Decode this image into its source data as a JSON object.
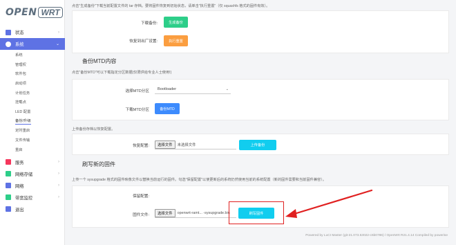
{
  "logo": {
    "open": "OPEN",
    "wrt": "WRT"
  },
  "menu": [
    {
      "label": "状态",
      "icon": "dashboard-icon",
      "color": "#5e72e4",
      "active": false
    },
    {
      "label": "系统",
      "icon": "gear-icon",
      "color": "#5e72e4",
      "active": true
    }
  ],
  "submenu": [
    "系统",
    "管理权",
    "软件包",
    "启动项",
    "计划任务",
    "挂载点",
    "LED 配置",
    "备份/升级",
    "定时重启",
    "文件传输",
    "重启"
  ],
  "menu_bottom": [
    {
      "label": "服务",
      "icon": "services-icon",
      "color": "#f5365c"
    },
    {
      "label": "网络存储",
      "icon": "storage-icon",
      "color": "#2dce89"
    },
    {
      "label": "网络",
      "icon": "network-icon",
      "color": "#5e72e4"
    },
    {
      "label": "带宽监控",
      "icon": "monitor-icon",
      "color": "#2dce89"
    },
    {
      "label": "退出",
      "icon": "logout-icon",
      "color": "#5e72e4"
    }
  ],
  "top_note": "点击\"生成备份\"下载当前配置文件的 tar 存档。要将固件恢复到初始状态，请单击\"执行重置\"（仅 squashfs 格式的固件有效）。",
  "backup": {
    "download_label": "下载备份:",
    "download_btn": "生成备份",
    "reset_label": "恢复到出厂设置:",
    "reset_btn": "执行重置"
  },
  "mtd": {
    "title": "备份MTD内容",
    "note": "点击\"备份MTD\"可以下载指定分区数据(仅限供给专业人士使用!)",
    "select_label": "选择MTD分区",
    "select_value": "Bootloader",
    "download_label": "下载MTD分区",
    "download_btn": "备份MTD"
  },
  "restore": {
    "note": "上传备份存档以恢复配置。",
    "label": "恢复配置:",
    "file_btn": "选择文件",
    "file_text": "未选择文件",
    "upload_btn": "上传备份"
  },
  "flash": {
    "title": "刷写新的固件",
    "note": "上传一个 sysupgrade 格式的固件映像文件以替换当前运行的固件。勾选\"保留配置\"以使更新后的系统仍然使用当前的系统配置（新的固件需要和当前固件兼容）。",
    "keep_label": "保留配置:",
    "file_label": "固件文件:",
    "file_btn": "选择文件",
    "file_text": "openwrt-ramt... -sysupgrade.bin",
    "flash_btn": "刷写固件"
  },
  "footer": "Powered by LuCI Master (git-21.073.53022-c6b0786) / OpenWrt R21.4.14 Compiled by powerise",
  "colors": {
    "accent": "#5e72e4",
    "arrow": "#e02020"
  }
}
